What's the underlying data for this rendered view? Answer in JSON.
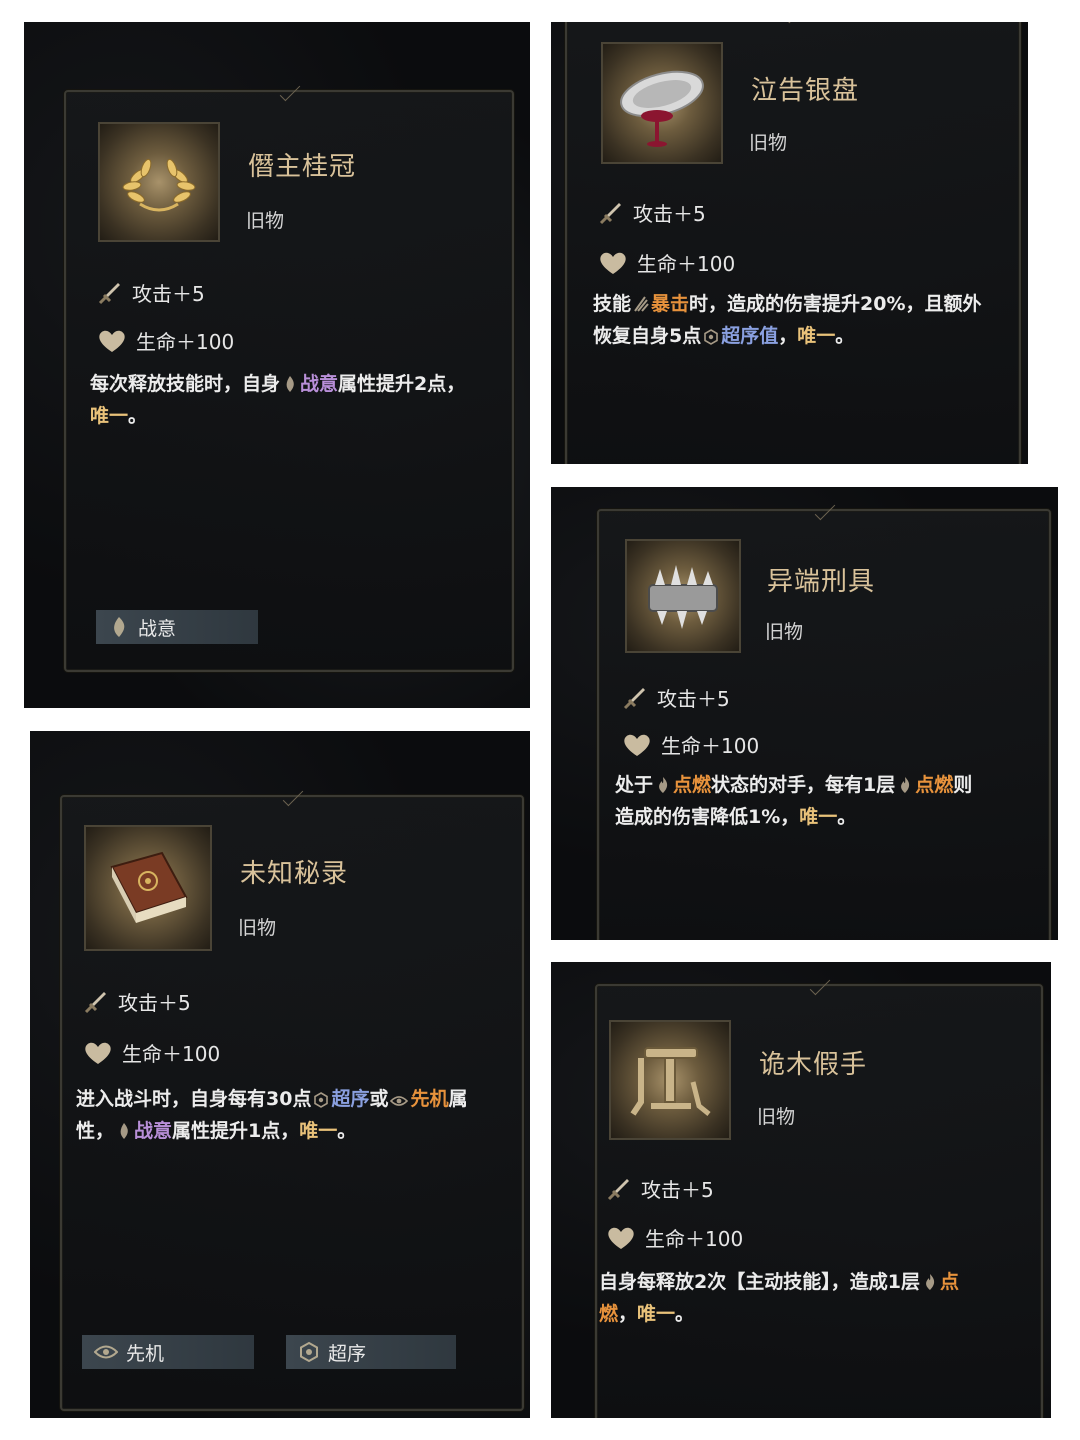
{
  "cards": [
    {
      "name": "僭主桂冠",
      "type": "旧物",
      "attack": "攻击＋5",
      "life": "生命＋100",
      "desc": [
        "每次释放技能时，自身",
        "战意",
        "属性提升2点，",
        "唯一",
        "。"
      ],
      "tags": [
        "战意"
      ]
    },
    {
      "name": "泣告银盘",
      "type": "旧物",
      "attack": "攻击＋5",
      "life": "生命＋100",
      "desc": [
        "技能",
        "暴击",
        "时，造成的伤害提升20%，且额外恢复自身5点",
        "超序值",
        "，",
        "唯一",
        "。"
      ],
      "tags": []
    },
    {
      "name": "异端刑具",
      "type": "旧物",
      "attack": "攻击＋5",
      "life": "生命＋100",
      "desc": [
        "处于",
        "点燃",
        "状态的对手，每有1层",
        "点燃",
        "则造成的伤害降低1%，",
        "唯一",
        "。"
      ],
      "tags": []
    },
    {
      "name": "未知秘录",
      "type": "旧物",
      "attack": "攻击＋5",
      "life": "生命＋100",
      "desc": [
        "进入战斗时，自身每有30点",
        "超序",
        "或",
        "先机",
        "属性，",
        "战意",
        "属性提升1点，",
        "唯一",
        "。"
      ],
      "tags": [
        "先机",
        "超序"
      ]
    },
    {
      "name": "诡木假手",
      "type": "旧物",
      "attack": "攻击＋5",
      "life": "生命＋100",
      "desc": [
        "自身每释放2次【主动技能】，造成1层",
        "点燃",
        "，",
        "唯一",
        "。"
      ],
      "tags": []
    }
  ],
  "icons": {
    "attack": "dagger-icon",
    "life": "heart-icon",
    "zhanyi": "flame-leaf-icon",
    "chaoxu": "hexagon-rune-icon",
    "xianji": "eye-icon",
    "dianran": "fire-icon",
    "baoji": "claw-icon"
  },
  "colors": {
    "name": "#d9c29a",
    "zhanyi": "#b88fd8",
    "dianran": "#e7923c",
    "chaoxu": "#8aa0e0",
    "unique": "#e9c27a"
  }
}
